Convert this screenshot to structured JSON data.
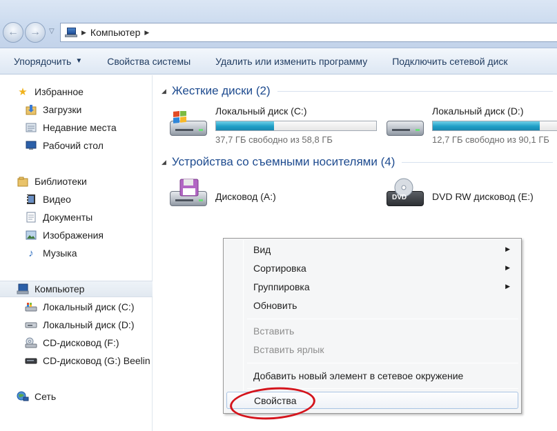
{
  "address": {
    "breadcrumb": "Компьютер"
  },
  "toolbar": {
    "organize": "Упорядочить",
    "system_properties": "Свойства системы",
    "uninstall": "Удалить или изменить программу",
    "map_drive": "Подключить сетевой диск"
  },
  "nav": {
    "favorites": "Избранное",
    "downloads": "Загрузки",
    "recent": "Недавние места",
    "desktop": "Рабочий стол",
    "libraries": "Библиотеки",
    "video": "Видео",
    "documents": "Документы",
    "images": "Изображения",
    "music": "Музыка",
    "computer": "Компьютер",
    "drive_c": "Локальный диск (C:)",
    "drive_d": "Локальный диск (D:)",
    "cd_f": "CD-дисковод (F:)",
    "cd_g": "CD-дисковод (G:) Beelin",
    "network": "Сеть"
  },
  "groups": {
    "hdd": "Жесткие диски (2)",
    "removable": "Устройства со съемными носителями (4)"
  },
  "drives": {
    "c": {
      "label": "Локальный диск (C:)",
      "free": "37,7 ГБ свободно из 58,8 ГБ",
      "used_fraction": 0.36
    },
    "d": {
      "label": "Локальный диск (D:)",
      "free": "12,7 ГБ свободно из 90,1 ГБ",
      "used_fraction": 0.86
    },
    "a": {
      "label": "Дисковод (A:)"
    },
    "e": {
      "label": "DVD RW дисковод (E:)",
      "badge": "DVD"
    }
  },
  "context_menu": {
    "view": "Вид",
    "sort": "Сортировка",
    "group": "Группировка",
    "refresh": "Обновить",
    "paste": "Вставить",
    "paste_shortcut": "Вставить ярлык",
    "add_network": "Добавить новый элемент в сетевое окружение",
    "properties": "Свойства"
  },
  "colors": {
    "highlight_oval": "#d4141c",
    "group_title": "#1e4b8f",
    "bar_fill": "#1f9fc7"
  }
}
